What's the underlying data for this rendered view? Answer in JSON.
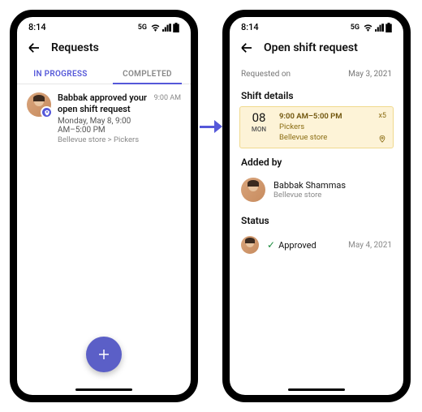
{
  "statusbar": {
    "time": "8:14",
    "network": "5G"
  },
  "leftScreen": {
    "title": "Requests",
    "tabs": {
      "inProgress": "IN PROGRESS",
      "completed": "COMPLETED"
    },
    "item": {
      "title": "Babbak approved your open shift request",
      "subtitle": "Monday, May 8, 9:00 AM–5:00 PM",
      "meta": "Bellevue store > Pickers",
      "time": "9:00 AM"
    }
  },
  "rightScreen": {
    "title": "Open shift request",
    "requestedOn": {
      "label": "Requested on",
      "date": "May 3, 2021"
    },
    "shiftDetails": {
      "heading": "Shift details",
      "dayNum": "08",
      "dayName": "MON",
      "time": "9:00 AM–5:00 PM",
      "group": "Pickers",
      "location": "Bellevue store",
      "count": "x5"
    },
    "addedBy": {
      "heading": "Added by",
      "name": "Babbak Shammas",
      "store": "Bellevue store"
    },
    "status": {
      "heading": "Status",
      "value": "Approved",
      "date": "May 4, 2021"
    }
  }
}
